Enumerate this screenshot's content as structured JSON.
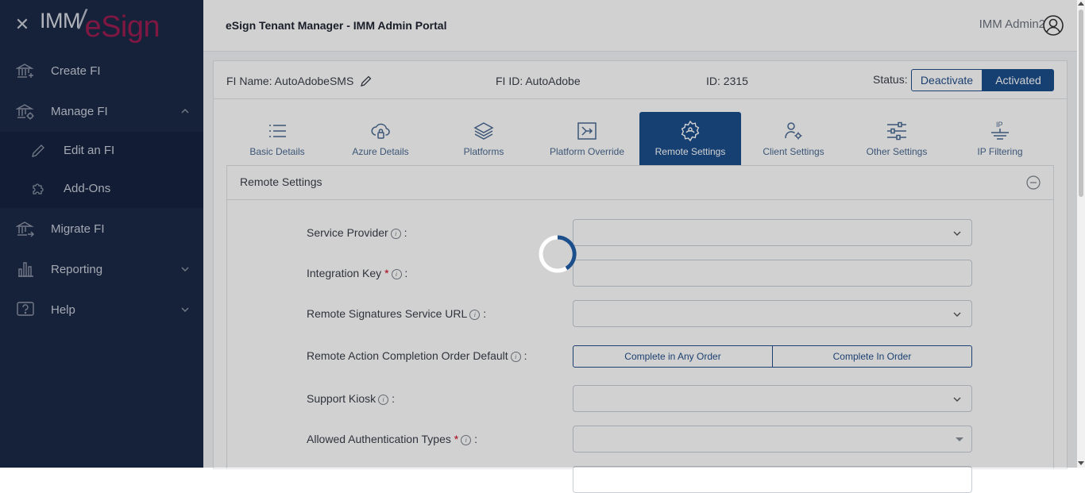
{
  "brand": {
    "imm": "IMM",
    "esign": "eSign"
  },
  "sidebar": {
    "items": [
      {
        "label": "Create FI",
        "icon": "bank-plus-icon"
      },
      {
        "label": "Manage FI",
        "icon": "bank-gear-icon",
        "expanded": true
      },
      {
        "label": "Edit an FI",
        "icon": "pencil-icon",
        "sub": true
      },
      {
        "label": "Add-Ons",
        "icon": "puzzle-icon",
        "sub": true
      },
      {
        "label": "Migrate FI",
        "icon": "bank-arrow-icon"
      },
      {
        "label": "Reporting",
        "icon": "bar-chart-icon"
      },
      {
        "label": "Help",
        "icon": "help-icon"
      }
    ]
  },
  "header": {
    "title": "eSign Tenant Manager - IMM Admin Portal",
    "user": "IMM Admin2"
  },
  "fi": {
    "name_label": "FI Name: AutoAdobeSMS",
    "id_label": "FI ID: AutoAdobe",
    "num_label": "ID: 2315",
    "status_label": "Status:",
    "deactivate": "Deactivate",
    "activated": "Activated"
  },
  "tabs": [
    {
      "label": "Basic Details",
      "icon": "list-icon"
    },
    {
      "label": "Azure Details",
      "icon": "cloud-lock-icon"
    },
    {
      "label": "Platforms",
      "icon": "layers-icon"
    },
    {
      "label": "Platform Override",
      "icon": "override-icon"
    },
    {
      "label": "Remote Settings",
      "icon": "remote-gear-icon",
      "active": true
    },
    {
      "label": "Client Settings",
      "icon": "user-gear-icon"
    },
    {
      "label": "Other Settings",
      "icon": "sliders-icon"
    },
    {
      "label": "IP Filtering",
      "icon": "ip-filter-icon"
    }
  ],
  "section": {
    "title": "Remote Settings",
    "fields": {
      "service_provider": "Service Provider",
      "integration_key": "Integration Key",
      "remote_url": "Remote Signatures Service URL",
      "completion_order": "Remote Action Completion Order Default",
      "support_kiosk": "Support Kiosk",
      "auth_types": "Allowed Authentication Types"
    },
    "order_options": [
      "Complete in Any Order",
      "Complete In Order"
    ],
    "required_mark": "*",
    "colon": ":"
  },
  "colors": {
    "sidebar": "#1b2a47",
    "accent": "#1c4e8c",
    "brand": "#9b1d52"
  }
}
